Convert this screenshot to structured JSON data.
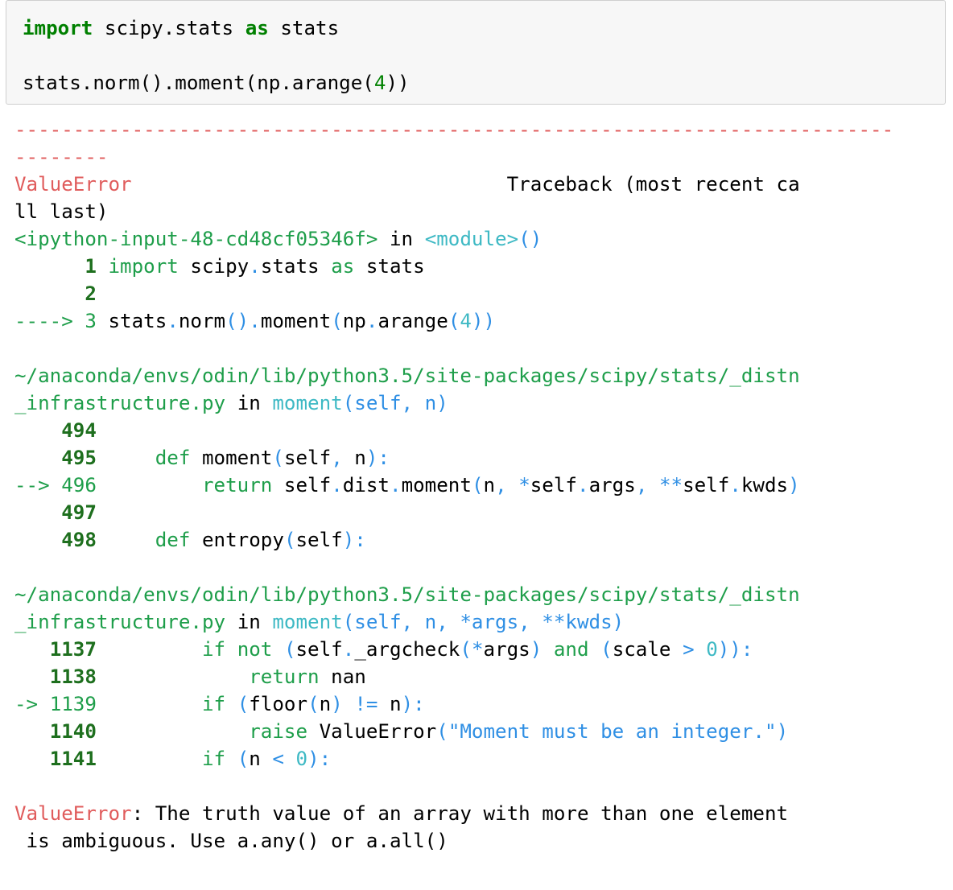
{
  "input_cell": {
    "lines": [
      {
        "kw1": "import",
        "mid": " scipy.stats ",
        "kw2": "as",
        "tail": " stats"
      },
      {
        "text": ""
      },
      {
        "pre": "stats.norm().moment(np.arange(",
        "num": "4",
        "post": "))"
      }
    ]
  },
  "traceback": {
    "dashes_line1": "---------------------------------------------------------------------------",
    "dashes_line2": "--------",
    "error_name": "ValueError",
    "header_spacing": "                                ",
    "header_text": "Traceback (most recent ca",
    "header_wrap": "ll last)",
    "frames": [
      {
        "location": "<ipython-input-48-cd48cf05346f>",
        "in_word": "in",
        "func": "<module>",
        "func_parens": "()",
        "lines": [
          {
            "prefix": "      ",
            "lineno": "1",
            "tokens": [
              {
                "t": " ",
                "c": ""
              },
              {
                "t": "import",
                "c": "green"
              },
              {
                "t": " scipy",
                "c": ""
              },
              {
                "t": ".",
                "c": "blue"
              },
              {
                "t": "stats ",
                "c": ""
              },
              {
                "t": "as",
                "c": "green"
              },
              {
                "t": " stats",
                "c": ""
              }
            ]
          },
          {
            "prefix": "      ",
            "lineno": "2",
            "tokens": []
          },
          {
            "prefix": "----> ",
            "lineno": "3",
            "current": true,
            "tokens": [
              {
                "t": " stats",
                "c": ""
              },
              {
                "t": ".",
                "c": "blue"
              },
              {
                "t": "norm",
                "c": ""
              },
              {
                "t": "()",
                "c": "blue"
              },
              {
                "t": ".",
                "c": "blue"
              },
              {
                "t": "moment",
                "c": ""
              },
              {
                "t": "(",
                "c": "blue"
              },
              {
                "t": "np",
                "c": ""
              },
              {
                "t": ".",
                "c": "blue"
              },
              {
                "t": "arange",
                "c": ""
              },
              {
                "t": "(",
                "c": "blue"
              },
              {
                "t": "4",
                "c": "cyan"
              },
              {
                "t": "))",
                "c": "blue"
              }
            ]
          }
        ]
      },
      {
        "path1": "~/anaconda/envs/odin/lib/python3.5/site-packages/scipy/stats/_distn",
        "path2": "_infrastructure.py",
        "in_word": "in",
        "func": "moment",
        "args": "(self, n)",
        "lines": [
          {
            "prefix": "    ",
            "lineno": "494",
            "tokens": []
          },
          {
            "prefix": "    ",
            "lineno": "495",
            "tokens": [
              {
                "t": "     ",
                "c": ""
              },
              {
                "t": "def",
                "c": "green"
              },
              {
                "t": " moment",
                "c": ""
              },
              {
                "t": "(",
                "c": "blue"
              },
              {
                "t": "self",
                "c": ""
              },
              {
                "t": ",",
                "c": "blue"
              },
              {
                "t": " n",
                "c": ""
              },
              {
                "t": "):",
                "c": "blue"
              }
            ]
          },
          {
            "prefix": "--> ",
            "lineno": "496",
            "current": true,
            "tokens": [
              {
                "t": "         ",
                "c": ""
              },
              {
                "t": "return",
                "c": "green"
              },
              {
                "t": " self",
                "c": ""
              },
              {
                "t": ".",
                "c": "blue"
              },
              {
                "t": "dist",
                "c": ""
              },
              {
                "t": ".",
                "c": "blue"
              },
              {
                "t": "moment",
                "c": ""
              },
              {
                "t": "(",
                "c": "blue"
              },
              {
                "t": "n",
                "c": ""
              },
              {
                "t": ",",
                "c": "blue"
              },
              {
                "t": " ",
                "c": ""
              },
              {
                "t": "*",
                "c": "blue"
              },
              {
                "t": "self",
                "c": ""
              },
              {
                "t": ".",
                "c": "blue"
              },
              {
                "t": "args",
                "c": ""
              },
              {
                "t": ",",
                "c": "blue"
              },
              {
                "t": " ",
                "c": ""
              },
              {
                "t": "**",
                "c": "blue"
              },
              {
                "t": "self",
                "c": ""
              },
              {
                "t": ".",
                "c": "blue"
              },
              {
                "t": "kwds",
                "c": ""
              },
              {
                "t": ")",
                "c": "blue"
              }
            ]
          },
          {
            "prefix": "    ",
            "lineno": "497",
            "tokens": []
          },
          {
            "prefix": "    ",
            "lineno": "498",
            "tokens": [
              {
                "t": "     ",
                "c": ""
              },
              {
                "t": "def",
                "c": "green"
              },
              {
                "t": " entropy",
                "c": ""
              },
              {
                "t": "(",
                "c": "blue"
              },
              {
                "t": "self",
                "c": ""
              },
              {
                "t": "):",
                "c": "blue"
              }
            ]
          }
        ]
      },
      {
        "path1": "~/anaconda/envs/odin/lib/python3.5/site-packages/scipy/stats/_distn",
        "path2": "_infrastructure.py",
        "in_word": "in",
        "func": "moment",
        "args": "(self, n, *args, **kwds)",
        "lines": [
          {
            "prefix": "   ",
            "lineno": "1137",
            "tokens": [
              {
                "t": "         ",
                "c": ""
              },
              {
                "t": "if",
                "c": "green"
              },
              {
                "t": " ",
                "c": ""
              },
              {
                "t": "not",
                "c": "green"
              },
              {
                "t": " ",
                "c": ""
              },
              {
                "t": "(",
                "c": "blue"
              },
              {
                "t": "self",
                "c": ""
              },
              {
                "t": ".",
                "c": "blue"
              },
              {
                "t": "_argcheck",
                "c": ""
              },
              {
                "t": "(",
                "c": "blue"
              },
              {
                "t": "*",
                "c": "blue"
              },
              {
                "t": "args",
                "c": ""
              },
              {
                "t": ")",
                "c": "blue"
              },
              {
                "t": " ",
                "c": ""
              },
              {
                "t": "and",
                "c": "green"
              },
              {
                "t": " ",
                "c": ""
              },
              {
                "t": "(",
                "c": "blue"
              },
              {
                "t": "scale ",
                "c": ""
              },
              {
                "t": ">",
                "c": "blue"
              },
              {
                "t": " ",
                "c": ""
              },
              {
                "t": "0",
                "c": "cyan"
              },
              {
                "t": ")):",
                "c": "blue"
              }
            ]
          },
          {
            "prefix": "   ",
            "lineno": "1138",
            "tokens": [
              {
                "t": "             ",
                "c": ""
              },
              {
                "t": "return",
                "c": "green"
              },
              {
                "t": " nan",
                "c": ""
              }
            ]
          },
          {
            "prefix": "-> ",
            "lineno": "1139",
            "current": true,
            "tokens": [
              {
                "t": "         ",
                "c": ""
              },
              {
                "t": "if",
                "c": "green"
              },
              {
                "t": " ",
                "c": ""
              },
              {
                "t": "(",
                "c": "blue"
              },
              {
                "t": "floor",
                "c": ""
              },
              {
                "t": "(",
                "c": "blue"
              },
              {
                "t": "n",
                "c": ""
              },
              {
                "t": ")",
                "c": "blue"
              },
              {
                "t": " ",
                "c": ""
              },
              {
                "t": "!=",
                "c": "blue"
              },
              {
                "t": " n",
                "c": ""
              },
              {
                "t": "):",
                "c": "blue"
              }
            ]
          },
          {
            "prefix": "   ",
            "lineno": "1140",
            "tokens": [
              {
                "t": "             ",
                "c": ""
              },
              {
                "t": "raise",
                "c": "green"
              },
              {
                "t": " ValueError",
                "c": ""
              },
              {
                "t": "(",
                "c": "blue"
              },
              {
                "t": "\"Moment must be an integer.\"",
                "c": "blue"
              },
              {
                "t": ")",
                "c": "blue"
              }
            ]
          },
          {
            "prefix": "   ",
            "lineno": "1141",
            "tokens": [
              {
                "t": "         ",
                "c": ""
              },
              {
                "t": "if",
                "c": "green"
              },
              {
                "t": " ",
                "c": ""
              },
              {
                "t": "(",
                "c": "blue"
              },
              {
                "t": "n ",
                "c": ""
              },
              {
                "t": "<",
                "c": "blue"
              },
              {
                "t": " ",
                "c": ""
              },
              {
                "t": "0",
                "c": "cyan"
              },
              {
                "t": "):",
                "c": "blue"
              }
            ]
          }
        ]
      }
    ],
    "final_error_name": "ValueError",
    "final_message_1": ": The truth value of an array with more than one element",
    "final_message_2": " is ambiguous. Use a.any() or a.all()"
  },
  "colors": {
    "error_red": "#e05c5c",
    "path_green": "#1e9e4a",
    "lineno_green": "#1e6f1e",
    "func_cyan": "#3eb9c4",
    "punct_blue": "#2f8fe4",
    "cell_bg": "#f7f7f7",
    "cell_border": "#cfcfcf"
  }
}
